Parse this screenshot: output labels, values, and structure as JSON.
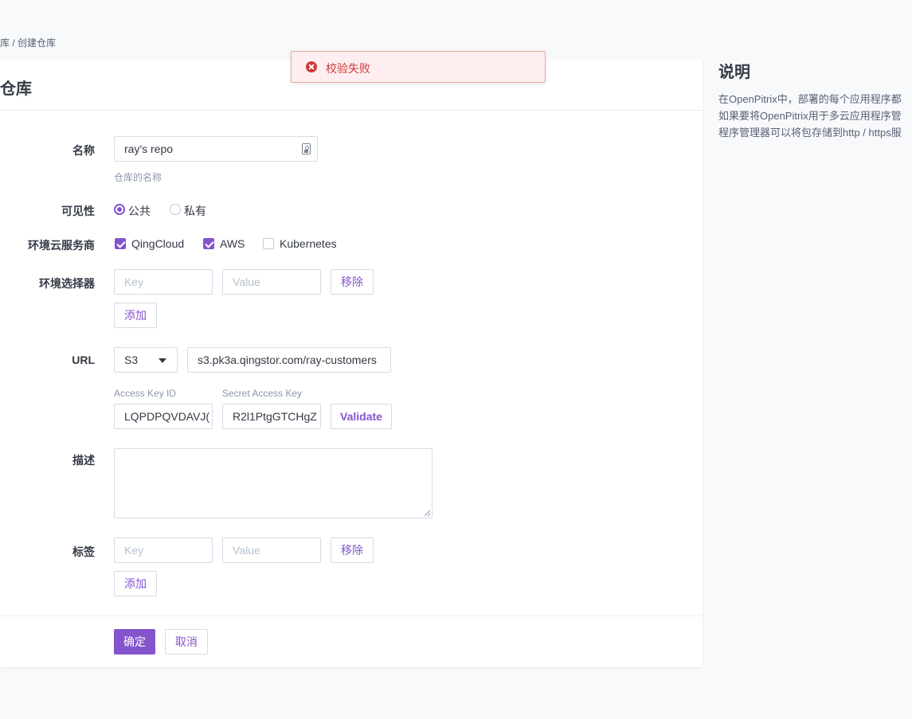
{
  "breadcrumb": "库 / 创建仓库",
  "card": {
    "title": "仓库"
  },
  "toast": {
    "message": "校验失败"
  },
  "form": {
    "name": {
      "label": "名称",
      "value": "ray's repo",
      "hint": "仓库的名称"
    },
    "visibility": {
      "label": "可见性",
      "options": [
        "公共",
        "私有"
      ],
      "selected": "公共"
    },
    "providers": {
      "label": "环境云服务商",
      "options": [
        {
          "label": "QingCloud",
          "checked": true
        },
        {
          "label": "AWS",
          "checked": true
        },
        {
          "label": "Kubernetes",
          "checked": false
        }
      ]
    },
    "selector": {
      "label": "环境选择器",
      "key_placeholder": "Key",
      "value_placeholder": "Value",
      "remove_label": "移除",
      "add_label": "添加"
    },
    "url": {
      "label": "URL",
      "protocol": "S3",
      "value": "s3.pk3a.qingstor.com/ray-customers",
      "access_key_label": "Access Key ID",
      "access_key_value": "LQPDPQVDAVJ(",
      "secret_key_label": "Secret Access Key",
      "secret_key_value": "R2l1PtgGTCHgZ",
      "validate_label": "Validate"
    },
    "description": {
      "label": "描述",
      "value": ""
    },
    "labels": {
      "label": "标签",
      "key_placeholder": "Key",
      "value_placeholder": "Value",
      "remove_label": "移除",
      "add_label": "添加"
    }
  },
  "actions": {
    "confirm": "确定",
    "cancel": "取消"
  },
  "aside": {
    "title": "说明",
    "lines": [
      "在OpenPitrix中，部署的每个应用程序都",
      "如果要将OpenPitrix用于多云应用程序管",
      "程序管理器可以将包存储到http / https服"
    ]
  },
  "colors": {
    "accent": "#8454cd",
    "error": "#cf3939",
    "error_bg": "#feeeef"
  }
}
